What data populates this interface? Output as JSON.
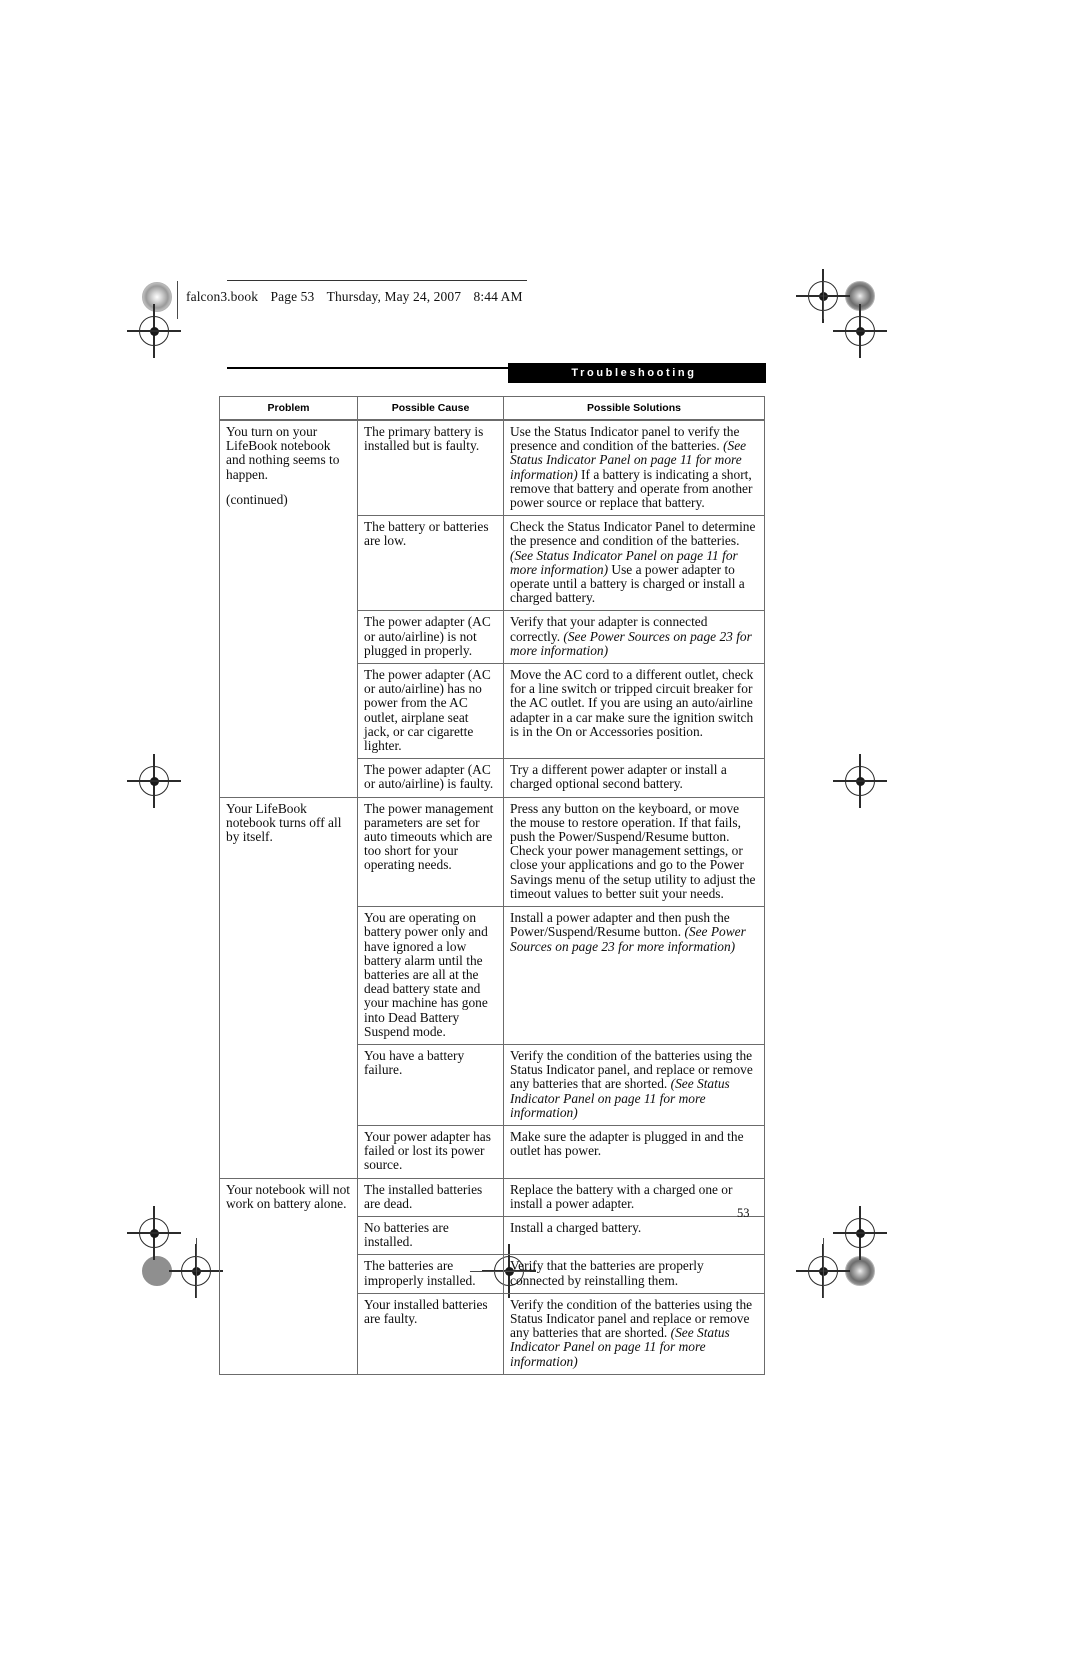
{
  "file_header": {
    "filename": "falcon3.book",
    "page_label": "Page 53",
    "day": "Thursday, May 24, 2007",
    "time": "8:44 AM"
  },
  "section": {
    "title": "Troubleshooting"
  },
  "page_number": "53",
  "table": {
    "headers": [
      "Problem",
      "Possible Cause",
      "Possible Solutions"
    ],
    "rows": [
      {
        "problem": "You turn on your LifeBook notebook and nothing seems to happen.",
        "problem_note": "(continued)",
        "cause": "The primary battery is installed but is faulty.",
        "solution_a": "Use the Status Indicator panel to verify the presence and condition of the batteries. ",
        "solution_i": "(See Status Indicator Panel on page 11 for more information)",
        "solution_b": " If a battery is indicating a short, remove that battery and operate from another power source or replace that battery."
      },
      {
        "cause": "The battery or batteries are low.",
        "solution_a": "Check the Status Indicator Panel to determine the presence and condition of the batteries. ",
        "solution_i": "(See Status Indicator Panel on page 11 for more information)",
        "solution_b": " Use a power adapter to operate until a battery is charged or install a charged battery."
      },
      {
        "cause": "The power adapter (AC or auto/airline) is not plugged in properly.",
        "solution_a": "Verify that your adapter is connected correctly. ",
        "solution_i": "(See Power Sources on page 23 for more information)",
        "solution_b": ""
      },
      {
        "cause": "The power adapter (AC or auto/airline) has no power from the AC outlet, airplane seat jack, or car cigarette lighter.",
        "solution_a": "Move the AC cord to a different outlet, check for a line switch or tripped circuit breaker for the AC outlet. If you are using an auto/airline adapter in a car make sure the ignition switch is in the On or Accessories position.",
        "solution_i": "",
        "solution_b": ""
      },
      {
        "cause": "The power adapter (AC or auto/airline) is faulty.",
        "solution_a": "Try a different power adapter or install a charged optional second battery.",
        "solution_i": "",
        "solution_b": ""
      },
      {
        "problem": "Your LifeBook notebook turns off all by itself.",
        "cause": "The power management parameters are set for auto timeouts which are too short for your operating needs.",
        "solution_a": "Press any button on the keyboard, or move the mouse to restore operation. If that fails, push the Power/Suspend/Resume button. Check your power management settings, or close your applications and go to the Power Savings menu of the setup utility to adjust the timeout values to better suit your needs.",
        "solution_i": "",
        "solution_b": ""
      },
      {
        "cause": "You are operating on battery power only and have ignored a low battery alarm until the batteries are all at the dead battery state and your machine has gone into Dead Battery Suspend mode.",
        "solution_a": "Install a power adapter and then push the Power/Suspend/Resume button. ",
        "solution_i": "(See Power Sources on page 23 for more information)",
        "solution_b": ""
      },
      {
        "cause": "You have a battery failure.",
        "solution_a": "Verify the condition of the batteries using the Status Indicator panel, and replace or remove any batteries that are shorted. ",
        "solution_i": "(See Status Indicator Panel on page 11 for more information)",
        "solution_b": ""
      },
      {
        "cause": "Your power adapter has failed or lost its power source.",
        "solution_a": "Make sure the adapter is plugged in and the outlet has power.",
        "solution_i": "",
        "solution_b": ""
      },
      {
        "problem": "Your notebook will not work on battery alone.",
        "cause": "The installed batteries are dead.",
        "solution_a": "Replace the battery with a charged one or install a power adapter.",
        "solution_i": "",
        "solution_b": ""
      },
      {
        "cause": "No batteries are installed.",
        "solution_a": "Install a charged battery.",
        "solution_i": "",
        "solution_b": ""
      },
      {
        "cause": "The batteries are improperly installed.",
        "solution_a": "Verify that the batteries are properly connected by reinstalling them.",
        "solution_i": "",
        "solution_b": ""
      },
      {
        "cause": "Your installed batteries are faulty.",
        "solution_a": "Verify the condition of the batteries using the Status Indicator panel and replace or remove any batteries that are shorted. ",
        "solution_i": "(See Status Indicator Panel on page 11 for more information)",
        "solution_b": ""
      }
    ]
  }
}
